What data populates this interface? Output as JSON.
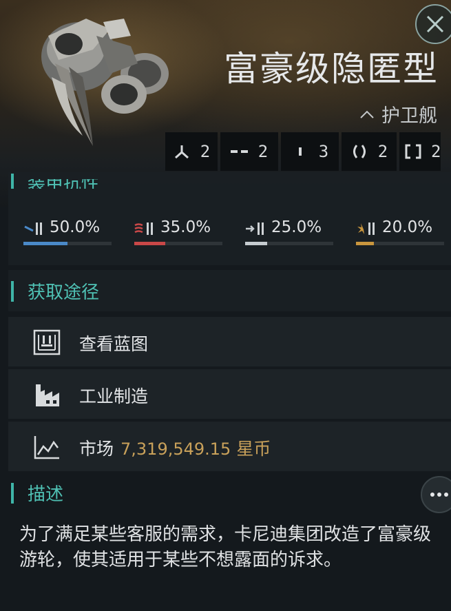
{
  "header": {
    "ship_name": "富豪级隐匿型",
    "ship_class": "护卫舰"
  },
  "slots": [
    {
      "icon": "turret-slot-icon",
      "count": "2"
    },
    {
      "icon": "launcher-slot-icon",
      "count": "2"
    },
    {
      "icon": "drone-slot-icon",
      "count": "3"
    },
    {
      "icon": "module-slot-icon",
      "count": "2"
    },
    {
      "icon": "rig-slot-icon",
      "count": "2"
    }
  ],
  "resistances": {
    "section_title_partial": "装甲抗性",
    "items": [
      {
        "icon": "em-resist-icon",
        "value": "50.0%",
        "level": 0.5,
        "color": "#4a89c8"
      },
      {
        "icon": "thermal-resist-icon",
        "value": "35.0%",
        "level": 0.35,
        "color": "#c94848"
      },
      {
        "icon": "kinetic-resist-icon",
        "value": "25.0%",
        "level": 0.25,
        "color": "#c6ccd0"
      },
      {
        "icon": "explosive-resist-icon",
        "value": "20.0%",
        "level": 0.2,
        "color": "#c9963e"
      }
    ]
  },
  "acquire": {
    "title": "获取途径",
    "blueprint_label": "查看蓝图",
    "industry_label": "工业制造",
    "market_label": "市场",
    "market_price": "7,319,549.15",
    "market_unit": "星币"
  },
  "description": {
    "title": "描述",
    "text": "为了满足某些客服的需求，卡尼迪集团改造了富豪级游轮，使其适用于某些不想露面的诉求。"
  },
  "colors": {
    "accent": "#4fc1b4",
    "price": "#c9a15a"
  }
}
